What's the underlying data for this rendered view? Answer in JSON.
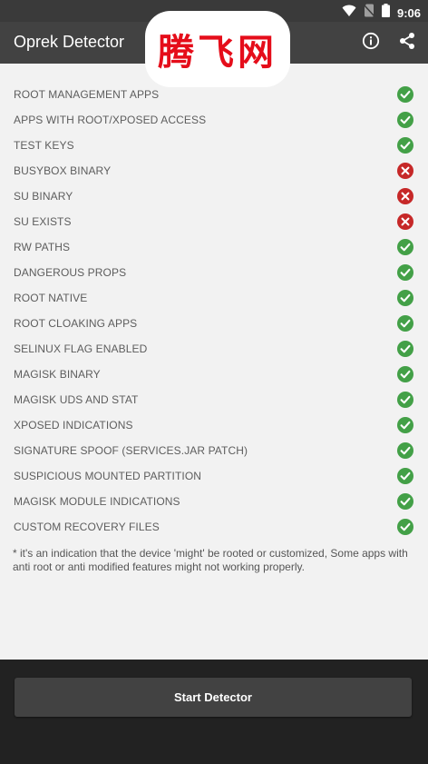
{
  "status_bar": {
    "time": "9:06",
    "icons": [
      "wifi-icon",
      "no-sim-icon",
      "battery-icon"
    ]
  },
  "app_bar": {
    "title": "Oprek Detector",
    "watermark": "腾飞网",
    "actions": [
      "info-icon",
      "share-icon"
    ]
  },
  "colors": {
    "pass": "#43a047",
    "fail": "#c62828",
    "appbar": "#424242"
  },
  "checks": [
    {
      "label": "ROOT MANAGEMENT APPS",
      "status": "pass"
    },
    {
      "label": "APPS WITH ROOT/XPOSED ACCESS",
      "status": "pass"
    },
    {
      "label": "TEST KEYS",
      "status": "pass"
    },
    {
      "label": "BUSYBOX BINARY",
      "status": "fail"
    },
    {
      "label": "SU BINARY",
      "status": "fail"
    },
    {
      "label": "SU EXISTS",
      "status": "fail"
    },
    {
      "label": "RW PATHS",
      "status": "pass"
    },
    {
      "label": "DANGEROUS PROPS",
      "status": "pass"
    },
    {
      "label": "ROOT NATIVE",
      "status": "pass"
    },
    {
      "label": "ROOT CLOAKING APPS",
      "status": "pass"
    },
    {
      "label": "SELINUX FLAG ENABLED",
      "status": "pass"
    },
    {
      "label": "MAGISK BINARY",
      "status": "pass"
    },
    {
      "label": "MAGISK UDS AND STAT",
      "status": "pass"
    },
    {
      "label": "XPOSED INDICATIONS",
      "status": "pass"
    },
    {
      "label": "SIGNATURE SPOOF (SERVICES.JAR PATCH)",
      "status": "pass"
    },
    {
      "label": "SUSPICIOUS MOUNTED PARTITION",
      "status": "pass"
    },
    {
      "label": "MAGISK MODULE INDICATIONS",
      "status": "pass"
    },
    {
      "label": "CUSTOM RECOVERY FILES",
      "status": "pass"
    }
  ],
  "footnote": "* it's an indication that the device 'might' be rooted or customized, Some apps with anti root or anti modified features might not working properly.",
  "start_button": {
    "label": "Start Detector"
  }
}
